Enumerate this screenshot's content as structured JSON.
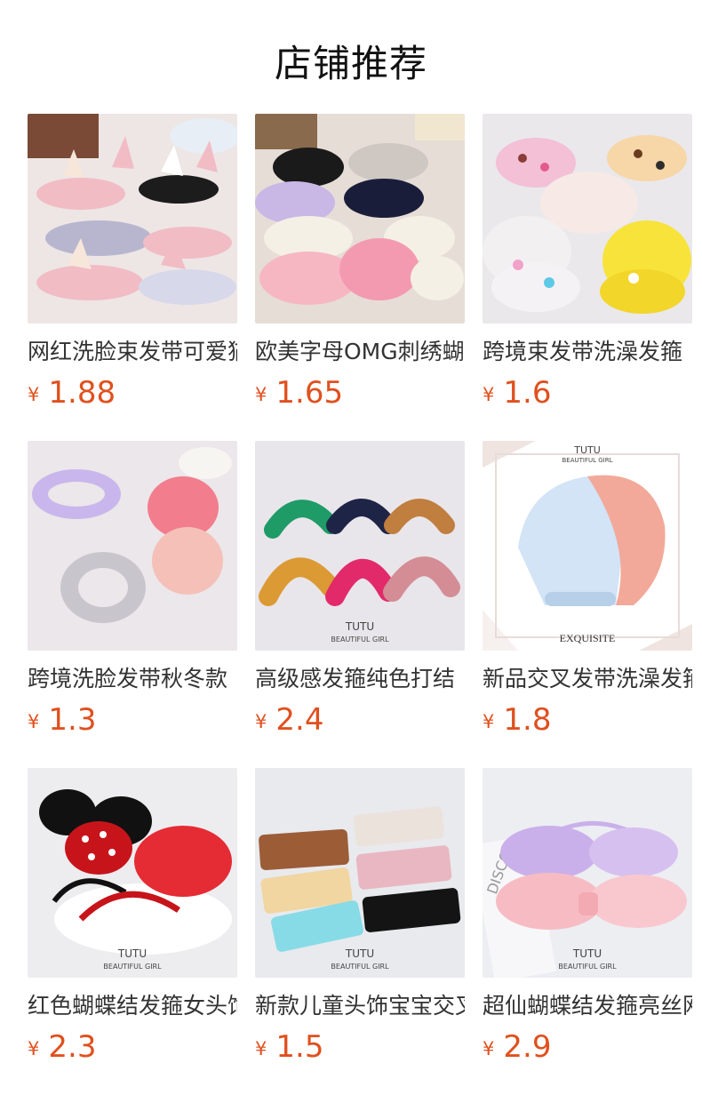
{
  "header": {
    "title": "店铺推荐"
  },
  "currency_symbol": "¥",
  "products": [
    {
      "name": "网红洗脸束发带可爱猫耳朵",
      "price": "1.88",
      "colors": [
        "#f2bcc4",
        "#f7e6da",
        "#1c1c1c",
        "#b8b6cf"
      ]
    },
    {
      "name": "欧美字母OMG刺绣蝴蝶结",
      "price": "1.65",
      "colors": [
        "#f49ab0",
        "#1a1d3a",
        "#f4f0e6",
        "#c9b7e6"
      ]
    },
    {
      "name": "跨境束发带洗澡发箍",
      "price": "1.6",
      "colors": [
        "#f3c0d6",
        "#f7d6a7",
        "#f7e33a",
        "#f3f0f2"
      ]
    },
    {
      "name": "跨境洗脸发带秋冬款",
      "price": "1.3",
      "colors": [
        "#c9b6ec",
        "#f27d8c",
        "#c8c6cc",
        "#f5c0b8"
      ]
    },
    {
      "name": "高级感发箍纯色打结",
      "price": "2.4",
      "colors": [
        "#1e9b66",
        "#1e2445",
        "#c07e3f",
        "#dc9a34",
        "#e22a6a",
        "#d48d95"
      ],
      "brand": "TUTU",
      "brand_sub": "BEAUTIFUL GIRL"
    },
    {
      "name": "新品交叉发带洗澡发箍",
      "price": "1.8",
      "colors": [
        "#d2e4f6",
        "#f2a999"
      ],
      "brand": "TUTU",
      "brand_sub": "BEAUTIFUL GIRL",
      "caption": "EXQUISITE"
    },
    {
      "name": "红色蝴蝶结发箍女头饰",
      "price": "2.3",
      "colors": [
        "#c7141b",
        "#111111",
        "#e52b34"
      ],
      "brand": "TUTU",
      "brand_sub": "BEAUTIFUL GIRL"
    },
    {
      "name": "新款儿童头饰宝宝交叉",
      "price": "1.5",
      "colors": [
        "#9c5c36",
        "#ece2dc",
        "#f1d6a2",
        "#e9b7c2",
        "#86dbe6",
        "#141414"
      ],
      "brand": "TUTU",
      "brand_sub": "BEAUTIFUL GIRL"
    },
    {
      "name": "超仙蝴蝶结发箍亮丝网纱",
      "price": "2.9",
      "colors": [
        "#c9b0ea",
        "#f7bcc3"
      ],
      "brand": "TUTU",
      "brand_sub": "BEAUTIFUL GIRL",
      "background_text": "DISCO"
    }
  ]
}
